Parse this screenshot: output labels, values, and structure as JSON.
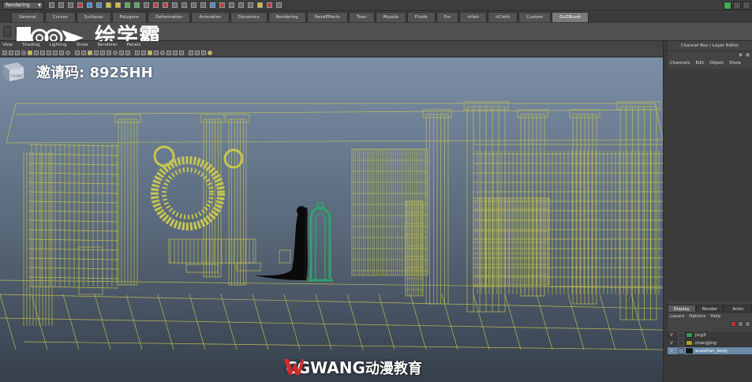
{
  "app": {
    "mode": "Rendering",
    "colors": {
      "wire": "#c6c650",
      "selected": "#2fa46a",
      "layer_sel": "#6a8aa8"
    }
  },
  "shelf": {
    "tabs": [
      "General",
      "Curves",
      "Surfaces",
      "Polygons",
      "Deformation",
      "Animation",
      "Dynamics",
      "Rendering",
      "PaintEffects",
      "Toon",
      "Muscle",
      "Fluids",
      "Fur",
      "nHair",
      "nCloth",
      "Custom",
      "GoZBrush"
    ],
    "active_tab": 16
  },
  "panel_menu": [
    "View",
    "Shading",
    "Lighting",
    "Show",
    "Renderer",
    "Panels"
  ],
  "viewport": {
    "camera_label": "FRONT"
  },
  "watermark": {
    "logo_text": "绘学霸",
    "invite": "邀请码: 8925HH",
    "cg_brand": "CGWANG",
    "cg_cn": "动漫教育"
  },
  "channel_box": {
    "title": "Channel Box / Layer Editor",
    "menu": [
      "Channels",
      "Edit",
      "Object",
      "Show"
    ]
  },
  "layer_editor": {
    "tabs": [
      "Display",
      "Render",
      "Anim"
    ],
    "active_tab": 0,
    "menu": [
      "Layers",
      "Options",
      "Help"
    ],
    "layers": [
      {
        "v": "V",
        "name": "jing3",
        "color": "#2e9a5a",
        "selected": false
      },
      {
        "v": "V",
        "name": "changjing",
        "color": "#a6a42c",
        "selected": false
      },
      {
        "v": "V",
        "name": "wuzetian_body",
        "color": "#111111",
        "selected": true
      }
    ]
  }
}
